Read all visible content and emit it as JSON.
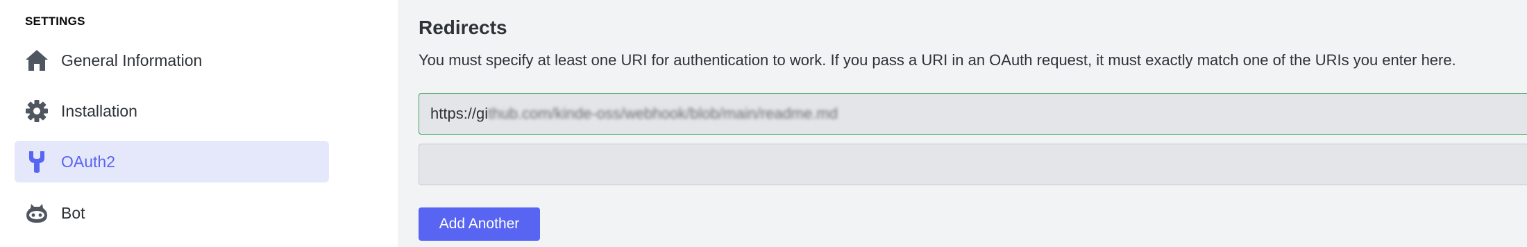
{
  "sidebar": {
    "section_title": "SETTINGS",
    "items": [
      {
        "label": "General Information",
        "icon": "home-icon",
        "active": false
      },
      {
        "label": "Installation",
        "icon": "gear-icon",
        "active": false
      },
      {
        "label": "OAuth2",
        "icon": "wrench-icon",
        "active": true
      },
      {
        "label": "Bot",
        "icon": "bot-icon",
        "active": false
      }
    ]
  },
  "redirects": {
    "heading": "Redirects",
    "description": "You must specify at least one URI for authentication to work. If you pass a URI in an OAuth request, it must exactly match one of the URIs you enter here.",
    "uris": [
      {
        "visible": "https://gi",
        "blurred": "thub.com/kinde-oss/webhook/blob/main/readme.md",
        "value": "https://github.com/kinde-oss/webhook/blob/main/readme.md"
      },
      {
        "visible": "",
        "blurred": "",
        "value": ""
      }
    ],
    "add_button": "Add Another"
  },
  "colors": {
    "accent": "#5865f2",
    "active_bg": "#e5e7fb",
    "valid_border": "#3ba55c"
  }
}
